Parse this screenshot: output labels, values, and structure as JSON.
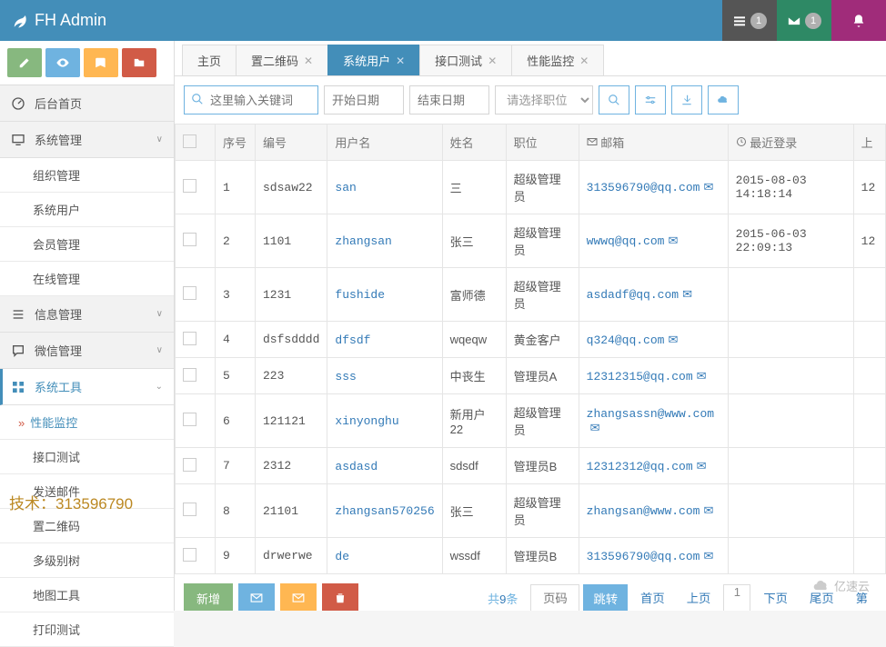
{
  "header": {
    "brand": "FH Admin",
    "tasks_badge": "1",
    "mail_badge": "1"
  },
  "sidebar": {
    "items": [
      {
        "icon": "dashboard",
        "label": "后台首页"
      },
      {
        "icon": "monitor",
        "label": "系统管理",
        "expand": true,
        "children": [
          "组织管理",
          "系统用户",
          "会员管理",
          "在线管理"
        ]
      },
      {
        "icon": "list",
        "label": "信息管理",
        "expand": true
      },
      {
        "icon": "chat",
        "label": "微信管理",
        "expand": true
      },
      {
        "icon": "grid",
        "label": "系统工具",
        "expand": true,
        "active": true,
        "children": [
          "性能监控",
          "接口测试",
          "发送邮件",
          "置二维码",
          "多级别树",
          "地图工具",
          "打印测试"
        ],
        "active_child": "性能监控"
      }
    ]
  },
  "tabs": [
    "主页",
    "置二维码",
    "系统用户",
    "接口测试",
    "性能监控"
  ],
  "active_tab": "系统用户",
  "filters": {
    "search_placeholder": "这里输入关键词",
    "start_date_placeholder": "开始日期",
    "end_date_placeholder": "结束日期",
    "role_placeholder": "请选择职位"
  },
  "columns": {
    "idx": "序号",
    "code": "编号",
    "user": "用户名",
    "name": "姓名",
    "role": "职位",
    "mail": "邮箱",
    "login": "最近登录",
    "last": "上"
  },
  "rows": [
    {
      "idx": "1",
      "code": "sdsaw22",
      "user": "san",
      "name": "三",
      "role": "超级管理员",
      "mail": "313596790@qq.com",
      "login": "2015-08-03 14:18:14",
      "last": "12"
    },
    {
      "idx": "2",
      "code": "1101",
      "user": "zhangsan",
      "name": "张三",
      "role": "超级管理员",
      "mail": "wwwq@qq.com",
      "login": "2015-06-03 22:09:13",
      "last": "12"
    },
    {
      "idx": "3",
      "code": "1231",
      "user": "fushide",
      "name": "富师德",
      "role": "超级管理员",
      "mail": "asdadf@qq.com",
      "login": "",
      "last": ""
    },
    {
      "idx": "4",
      "code": "dsfsdddd",
      "user": "dfsdf",
      "name": "wqeqw",
      "role": "黄金客户",
      "mail": "q324@qq.com",
      "login": "",
      "last": ""
    },
    {
      "idx": "5",
      "code": "223",
      "user": "sss",
      "name": "中丧生",
      "role": "管理员A",
      "mail": "12312315@qq.com",
      "login": "",
      "last": ""
    },
    {
      "idx": "6",
      "code": "121121",
      "user": "xinyonghu",
      "name": "新用户22",
      "role": "超级管理员",
      "mail": "zhangsassn@www.com",
      "login": "",
      "last": ""
    },
    {
      "idx": "7",
      "code": "2312",
      "user": "asdasd",
      "name": "sdsdf",
      "role": "管理员B",
      "mail": "12312312@qq.com",
      "login": "",
      "last": ""
    },
    {
      "idx": "8",
      "code": "21101",
      "user": "zhangsan570256",
      "name": "张三",
      "role": "超级管理员",
      "mail": "zhangsan@www.com",
      "login": "",
      "last": ""
    },
    {
      "idx": "9",
      "code": "drwerwe",
      "user": "de",
      "name": "wssdf",
      "role": "管理员B",
      "mail": "313596790@qq.com",
      "login": "",
      "last": ""
    }
  ],
  "footer": {
    "add": "新增",
    "total_prefix": "共",
    "total_count": "9",
    "total_suffix": "条",
    "page_placeholder": "页码",
    "jump": "跳转",
    "first": "首页",
    "prev": "上页",
    "current": "1",
    "next": "下页",
    "last": "尾页",
    "more": "第"
  },
  "overlay": {
    "tech": "技术：313596790",
    "brand_wm": "亿速云"
  }
}
